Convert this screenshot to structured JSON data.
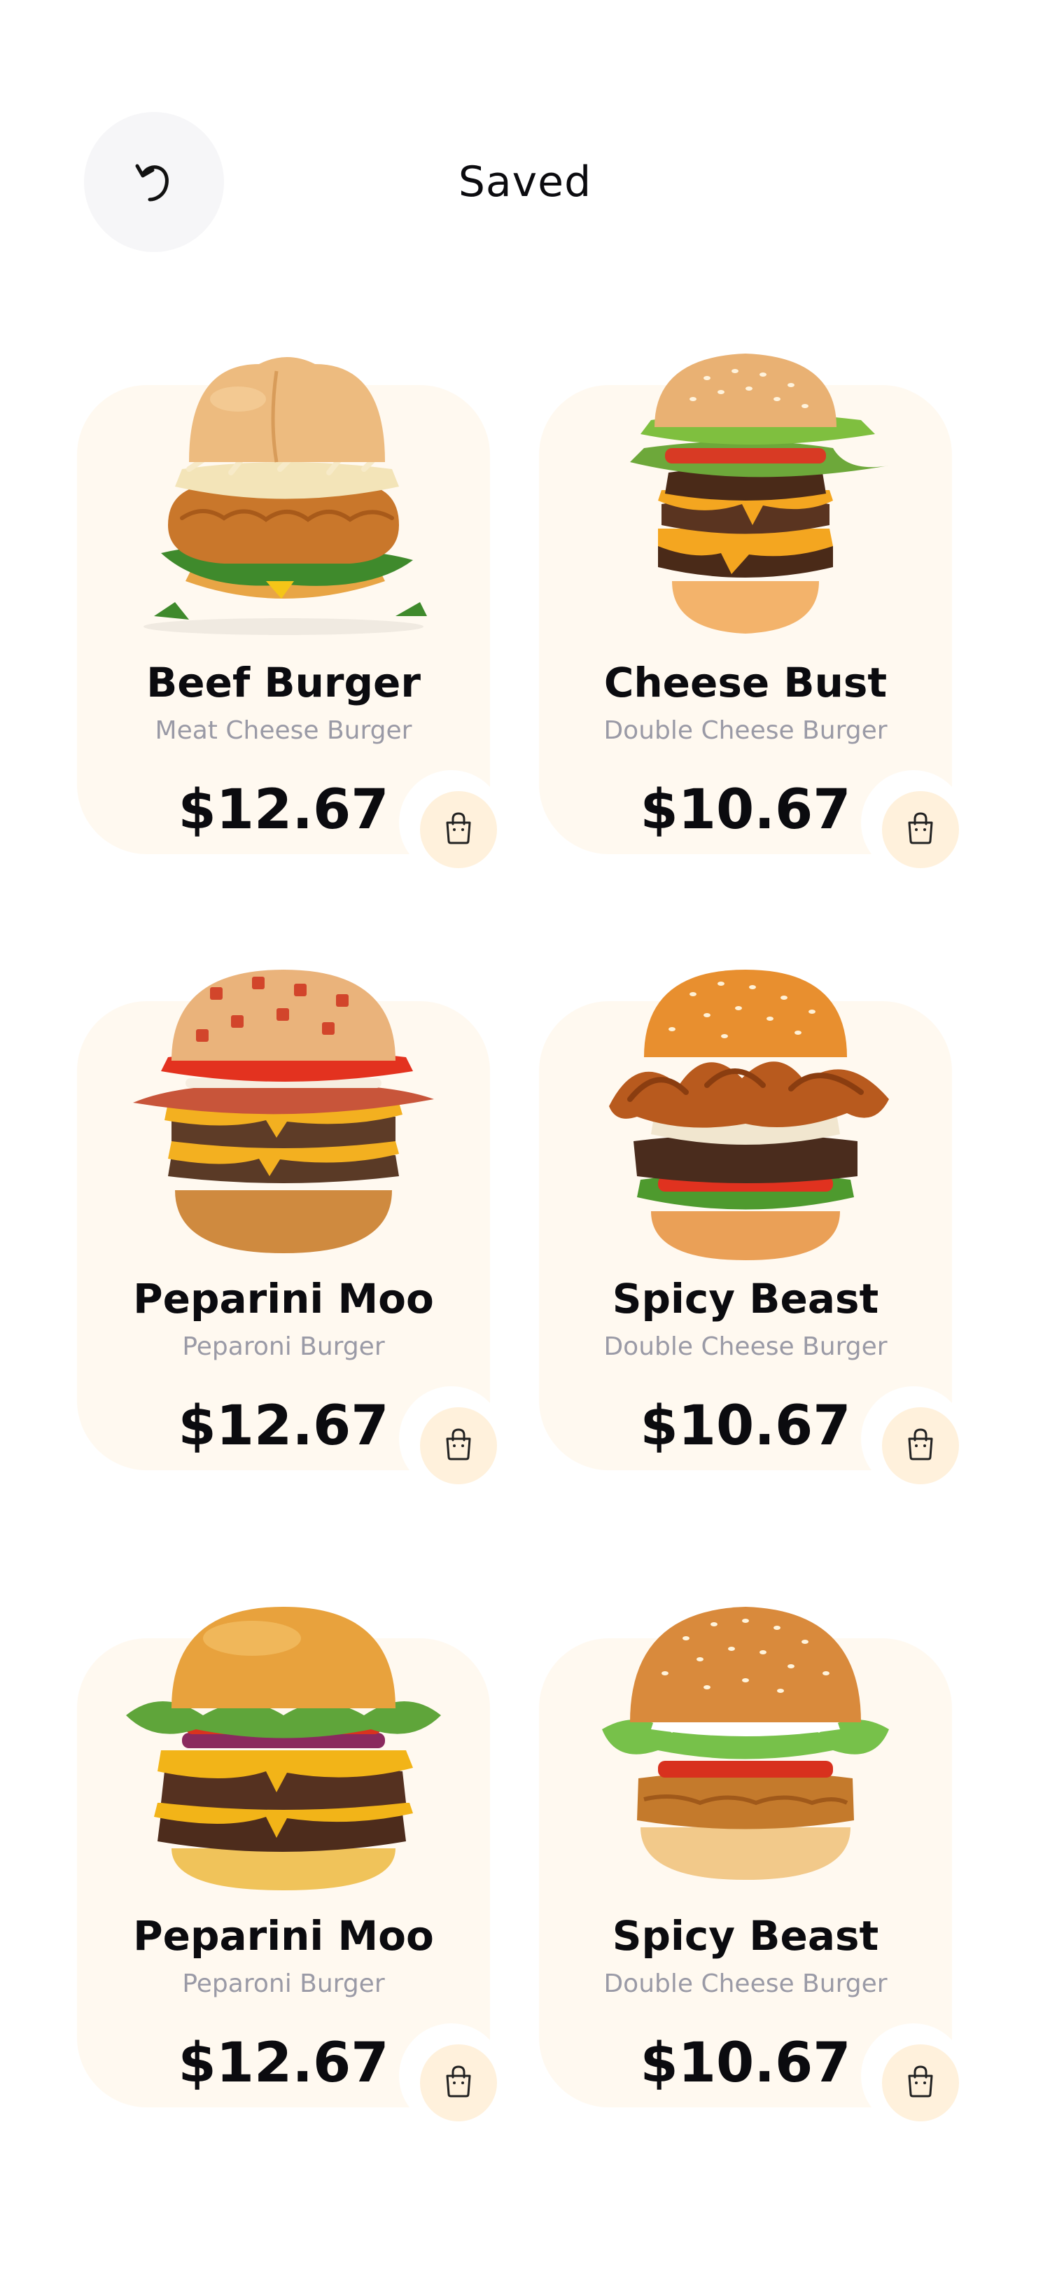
{
  "header": {
    "title": "Saved",
    "back_icon": "undo-arrow-icon"
  },
  "colors": {
    "card_background": "#fff9f0",
    "cart_button_background": "#fff1dc",
    "subtitle_text": "#9a9aa6",
    "title_text": "#0b0b0f",
    "back_button_background": "#f6f6f8"
  },
  "items": [
    {
      "name": "Beef Burger",
      "subtitle": "Meat Cheese Burger",
      "price": "$12.67",
      "image": "crispy-chicken-burger-image",
      "cart_icon": "shopping-bag-icon"
    },
    {
      "name": "Cheese Bust",
      "subtitle": "Double Cheese Burger",
      "price": "$10.67",
      "image": "double-cheeseburger-image",
      "cart_icon": "shopping-bag-icon"
    },
    {
      "name": "Peparini Moo",
      "subtitle": "Peparoni Burger",
      "price": "$12.67",
      "image": "pepperoni-bacon-burger-image",
      "cart_icon": "shopping-bag-icon"
    },
    {
      "name": "Spicy Beast",
      "subtitle": "Double Cheese Burger",
      "price": "$10.67",
      "image": "crispy-onion-burger-image",
      "cart_icon": "shopping-bag-icon"
    },
    {
      "name": "Peparini Moo",
      "subtitle": "Peparoni Burger",
      "price": "$12.67",
      "image": "double-patty-burger-image",
      "cart_icon": "shopping-bag-icon"
    },
    {
      "name": "Spicy Beast",
      "subtitle": "Double Cheese Burger",
      "price": "$10.67",
      "image": "veggie-patty-burger-image",
      "cart_icon": "shopping-bag-icon"
    }
  ]
}
